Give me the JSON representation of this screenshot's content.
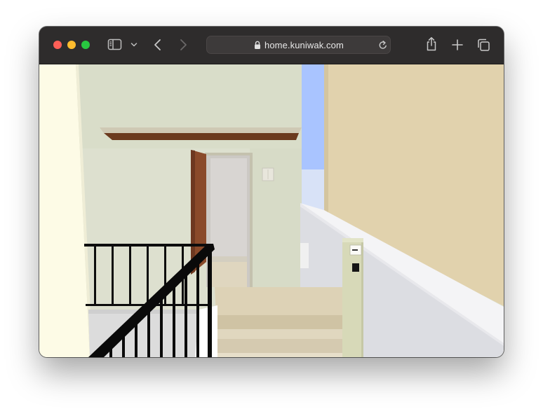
{
  "browser": {
    "url": "home.kuniwak.com",
    "icons": {
      "sidebar": "sidebar-icon",
      "sidebar_menu": "chevron-down-icon",
      "back": "chevron-left-icon",
      "forward": "chevron-right-icon",
      "lock": "lock-icon",
      "reload": "reload-icon",
      "share": "share-icon",
      "new_tab": "plus-icon",
      "tab_overview": "tabs-icon"
    }
  },
  "colors": {
    "titlebar": "#2e2c2c",
    "urlbar": "#3d3a3a",
    "close": "#fe5f57",
    "minimize": "#febc2e",
    "zoom": "#28c840",
    "wall_green": "#dfe2d1",
    "wall_yellow": "#e1d2ad",
    "floor_wood": "#ddd2b6",
    "door_wood": "#8a4a2a",
    "railing": "#0d0d0d",
    "sky": "#aac6ff"
  }
}
